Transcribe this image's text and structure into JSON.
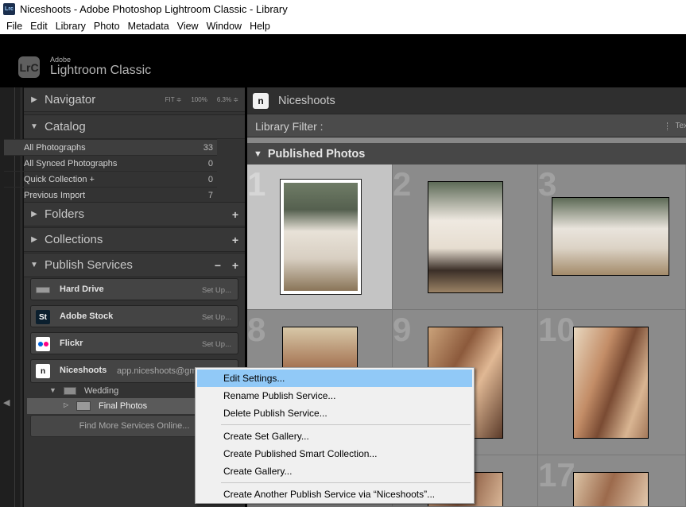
{
  "window": {
    "app_icon": "Lrc",
    "title": "Niceshoots - Adobe Photoshop Lightroom Classic - Library"
  },
  "menu": [
    "File",
    "Edit",
    "Library",
    "Photo",
    "Metadata",
    "View",
    "Window",
    "Help"
  ],
  "brand": {
    "logo": "LrC",
    "top": "Adobe",
    "main": "Lightroom Classic"
  },
  "left_panel": {
    "navigator": {
      "label": "Navigator",
      "options": [
        "FIT ≑",
        "100%",
        "6.3% ≑"
      ]
    },
    "catalog": {
      "label": "Catalog",
      "rows": [
        {
          "name": "All Photographs",
          "count": "33"
        },
        {
          "name": "All Synced Photographs",
          "count": "0"
        },
        {
          "name": "Quick Collection +",
          "count": "0"
        },
        {
          "name": "Previous Import",
          "count": "7"
        }
      ]
    },
    "folders": {
      "label": "Folders"
    },
    "collections": {
      "label": "Collections"
    },
    "publish": {
      "label": "Publish Services",
      "services": [
        {
          "name": "Hard Drive",
          "setup": "Set Up...",
          "icon": "hard-drive-icon",
          "icon_text": ""
        },
        {
          "name": "Adobe Stock",
          "setup": "Set Up...",
          "icon": "adobe-stock-icon",
          "icon_text": "St"
        },
        {
          "name": "Flickr",
          "setup": "Set Up...",
          "icon": "flickr-icon",
          "icon_text": ""
        }
      ],
      "niceshoots": {
        "name": "Niceshoots",
        "account": "app.niceshoots@gmail.com",
        "icon_text": "n"
      },
      "tree": {
        "set": "Wedding",
        "gallery": "Final Photos"
      },
      "find_more": "Find More Services Online..."
    }
  },
  "center": {
    "service_title": "Niceshoots",
    "filter_label": "Library Filter :",
    "filter_right": "Tex",
    "published_label": "Published Photos",
    "cells": [
      {
        "num": "1"
      },
      {
        "num": "2"
      },
      {
        "num": "3"
      },
      {
        "num": "8"
      },
      {
        "num": "9"
      },
      {
        "num": "10"
      },
      {
        "num": ""
      },
      {
        "num": ""
      },
      {
        "num": "17"
      }
    ]
  },
  "context_menu": {
    "items": [
      "Edit Settings...",
      "Rename Publish Service...",
      "Delete Publish Service...",
      "Create Set Gallery...",
      "Create Published Smart Collection...",
      "Create Gallery...",
      "Create Another Publish Service via “Niceshoots”..."
    ]
  }
}
